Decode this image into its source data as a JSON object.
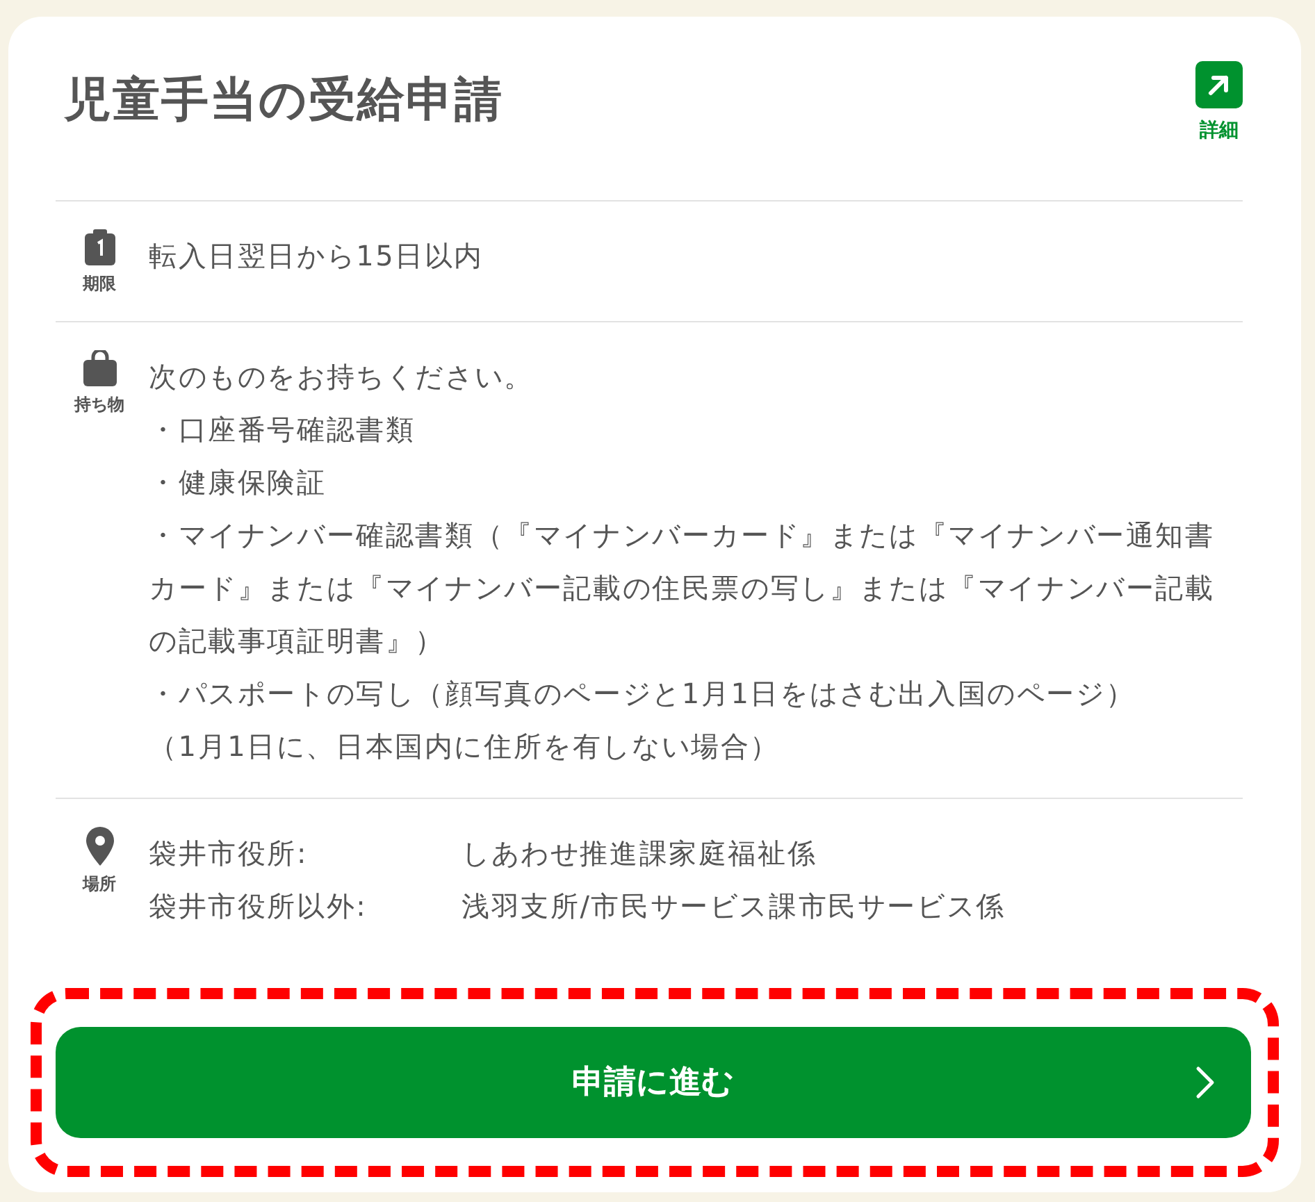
{
  "title": "児童手当の受給申請",
  "detail_link": {
    "label": "詳細"
  },
  "sections": [
    {
      "kind": "deadline",
      "label": "期限",
      "lines": [
        "転入日翌日から15日以内"
      ]
    },
    {
      "kind": "belongings",
      "label": "持ち物",
      "lines": [
        "次のものをお持ちください。",
        "・口座番号確認書類",
        "・健康保険証",
        "・マイナンバー確認書類（『マイナンバーカード』または『マイナンバー通知書カード』または『マイナンバー記載の住民票の写し』または『マイナンバー記載の記載事項証明書』）",
        "・パスポートの写し（顔写真のページと1月1日をはさむ出入国のページ）",
        "（1月1日に、日本国内に住所を有しない場合）"
      ]
    },
    {
      "kind": "place",
      "label": "場所",
      "places": [
        {
          "name": "袋井市役所:",
          "value": "しあわせ推進課家庭福祉係"
        },
        {
          "name": "袋井市役所以外:",
          "value": "浅羽支所/市民サービス課市民サービス係"
        }
      ]
    }
  ],
  "apply_button": {
    "label": "申請に進む",
    "highlighted": true
  }
}
